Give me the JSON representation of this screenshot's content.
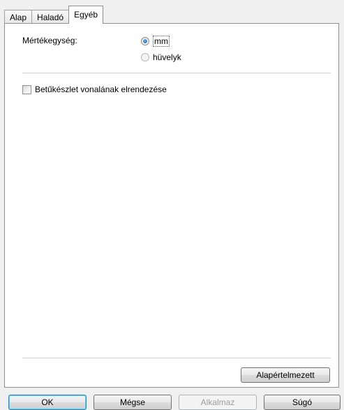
{
  "tabs": [
    {
      "label": "Alap",
      "active": false
    },
    {
      "label": "Haladó",
      "active": false
    },
    {
      "label": "Egyéb",
      "active": true
    }
  ],
  "units": {
    "label": "Mértékegység:",
    "options": [
      {
        "label": "mm",
        "checked": true
      },
      {
        "label": "hüvelyk",
        "checked": false
      }
    ]
  },
  "font_line_option": {
    "label": "Betűkészlet vonalának elrendezése",
    "checked": false
  },
  "default_button": "Alapértelmezett",
  "footer": {
    "ok": "OK",
    "cancel": "Mégse",
    "apply": "Alkalmaz",
    "help": "Súgó"
  },
  "colors": {
    "accent": "#3c7fb1",
    "panel_bg": "#ffffff",
    "dialog_bg": "#f0f0f0"
  }
}
